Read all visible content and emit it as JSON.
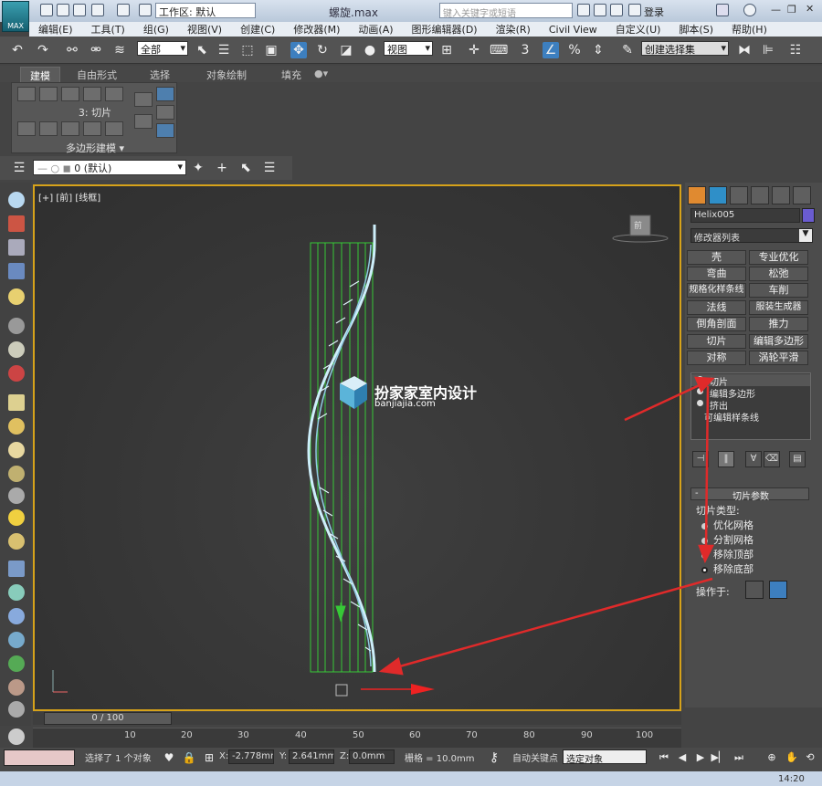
{
  "window": {
    "title": "螺旋.max",
    "workspace": "工作区: 默认",
    "search_placeholder": "键入关键字或短语",
    "login": "登录",
    "logo_text": "MAX"
  },
  "menu": [
    "编辑(E)",
    "工具(T)",
    "组(G)",
    "视图(V)",
    "创建(C)",
    "修改器(M)",
    "动画(A)",
    "图形编辑器(D)",
    "渲染(R)",
    "Civil View",
    "自定义(U)",
    "脚本(S)",
    "帮助(H)"
  ],
  "toolbar": {
    "selection_filter": "全部",
    "coord_system": "视图",
    "snap_value": "3",
    "named_selection": "创建选择集"
  },
  "ribbon": {
    "tabs": [
      "建模",
      "自由形式",
      "选择",
      "对象绘制",
      "填充"
    ],
    "active_tab": "建模",
    "panel_caption": "3: 切片",
    "panel_footer": "多边形建模"
  },
  "layer": {
    "current": "0 (默认)"
  },
  "viewport": {
    "label": "[+] [前] [线框]",
    "watermark_title": "扮家家室内设计",
    "watermark_url": "banjiajia.com",
    "cube_label": "前"
  },
  "command_panel": {
    "object_name": "Helix005",
    "object_color": "#6a5cd0",
    "modifier_list": "修改器列表",
    "modifier_buttons": [
      "壳",
      "专业优化",
      "弯曲",
      "松弛",
      "规格化样条线",
      "车削",
      "法线",
      "服装生成器",
      "倒角剖面",
      "推力",
      "切片",
      "编辑多边形",
      "对称",
      "涡轮平滑"
    ],
    "stack": [
      "切片",
      "编辑多边形",
      "挤出",
      "可编辑样条线"
    ],
    "rollout_title": "切片参数",
    "slice_type_label": "切片类型:",
    "slice_types": [
      "优化网格",
      "分割网格",
      "移除顶部",
      "移除底部"
    ],
    "slice_type_selected": "移除底部",
    "operate_on_label": "操作于:"
  },
  "timeline": {
    "frame": "0 / 100",
    "ticks": [
      "10",
      "20",
      "30",
      "40",
      "50",
      "60",
      "70",
      "80",
      "90",
      "100"
    ]
  },
  "status": {
    "selected": "选择了 1 个对象",
    "x_label": "X:",
    "x": "-2.778mm",
    "y_label": "Y:",
    "y": "2.641mm",
    "z_label": "Z:",
    "z": "0.0mm",
    "grid": "栅格 = 10.0mm",
    "auto_key": "自动关键点",
    "key_filter": "选定对象",
    "clock": "14:20"
  },
  "colors": {
    "viewport_border": "#d6a21a",
    "annotation_arrow": "#e02a2a",
    "slice_plane": "#37c837",
    "helix_mesh": "#bfe8f4"
  }
}
